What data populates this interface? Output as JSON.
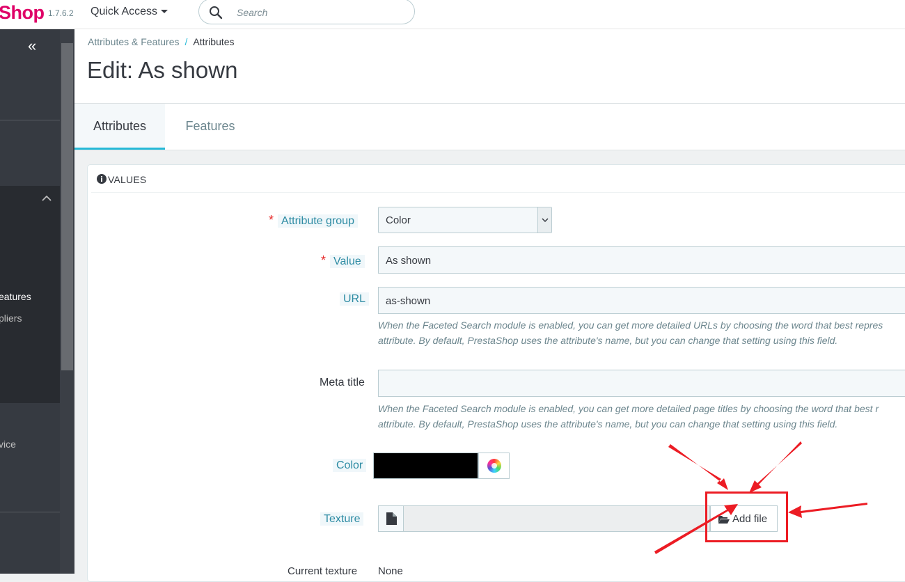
{
  "header": {
    "logo_text": "Shop",
    "version": "1.7.6.2",
    "quick_access_label": "Quick Access",
    "search_placeholder": "Search"
  },
  "sidebar": {
    "collapse_glyph": "«",
    "items": [
      {
        "label": "eatures",
        "active": true
      },
      {
        "label": "pliers",
        "active": false
      },
      {
        "label": "vice",
        "active": false
      }
    ]
  },
  "breadcrumb": {
    "parent": "Attributes & Features",
    "separator": "/",
    "current": "Attributes"
  },
  "page_title": "Edit: As shown",
  "tabs": [
    {
      "label": "Attributes",
      "active": true
    },
    {
      "label": "Features",
      "active": false
    }
  ],
  "panel": {
    "heading": "VALUES",
    "fields": {
      "attribute_group": {
        "label": "Attribute group",
        "required": true,
        "value": "Color"
      },
      "value": {
        "label": "Value",
        "required": true,
        "value": "As shown"
      },
      "url": {
        "label": "URL",
        "value": "as-shown",
        "help_line1": "When the Faceted Search module is enabled, you can get more detailed URLs by choosing the word that best repres",
        "help_line2": "attribute. By default, PrestaShop uses the attribute's name, but you can change that setting using this field."
      },
      "meta_title": {
        "label": "Meta title",
        "value": "",
        "help_line1": "When the Faceted Search module is enabled, you can get more detailed page titles by choosing the word that best r",
        "help_line2": "attribute. By default, PrestaShop uses the attribute's name, but you can change that setting using this field."
      },
      "color": {
        "label": "Color",
        "value": "#000000"
      },
      "texture": {
        "label": "Texture",
        "button_label": "Add file"
      },
      "current_texture": {
        "label": "Current texture",
        "value": "None"
      }
    }
  },
  "colors": {
    "accent": "#25b9d7",
    "brand": "#df0067",
    "annotation": "#ec1c24",
    "sidebar_bg": "#363a41"
  }
}
